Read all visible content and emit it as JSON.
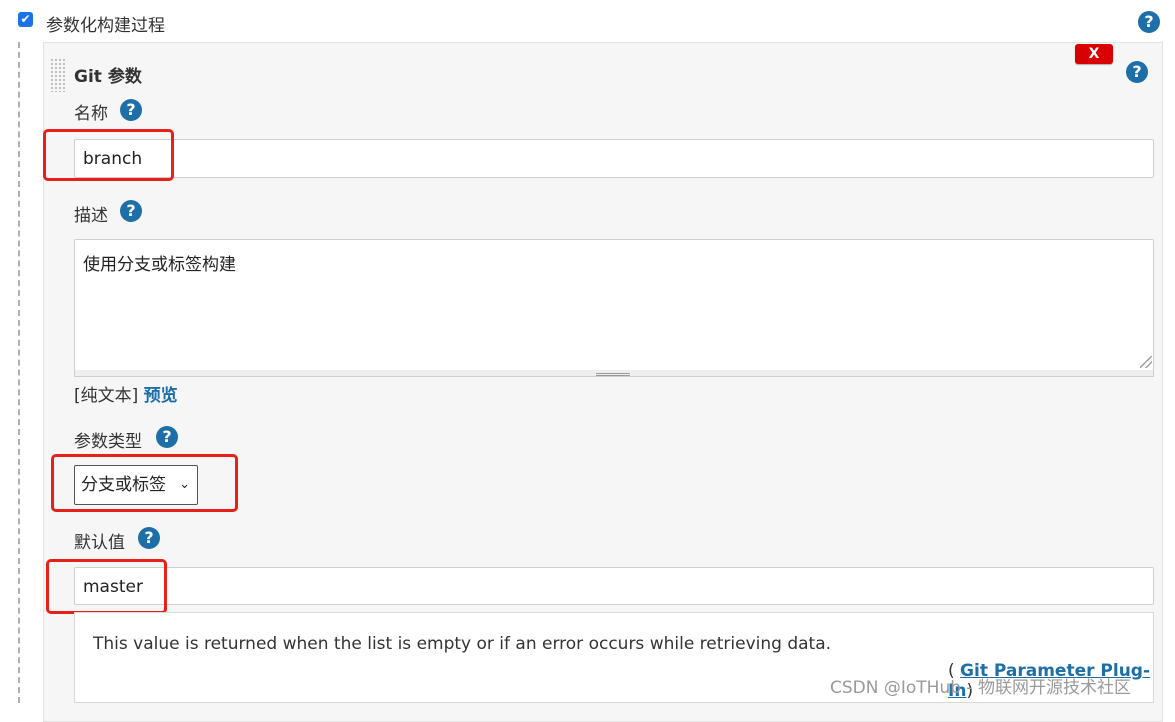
{
  "section": {
    "checkbox_label": "参数化构建过程",
    "checked": true
  },
  "parameter": {
    "type_title": "Git 参数",
    "delete_label": "X",
    "name_label": "名称",
    "name_value": "branch",
    "description_label": "描述",
    "description_value": "使用分支或标签构建",
    "format_plain": "[纯文本]",
    "format_preview": "预览",
    "param_type_label": "参数类型",
    "param_type_value": "分支或标签",
    "default_label": "默认值",
    "default_value": "master",
    "info_text": "This value is returned when the list is empty or if an error occurs while retrieving data.",
    "plugin_open": "(",
    "plugin_link": "Git Parameter Plug-In",
    "plugin_close": ")"
  },
  "icons": {
    "help": "?",
    "checkbox": "✔",
    "dropdown": "⌄"
  },
  "colors": {
    "help_blue": "#1e6fa8",
    "delete_red": "#d80000",
    "highlight_red": "#e8201a",
    "checkbox_blue": "#1a73e8"
  },
  "watermark": "CSDN @IoTHub - 物联网开源技术社区"
}
